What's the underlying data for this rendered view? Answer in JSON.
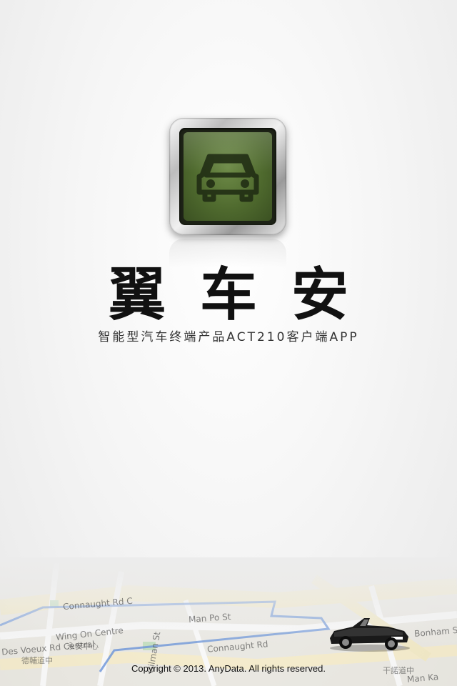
{
  "app": {
    "title": "翼车安",
    "subtitle": "智能型汽车终端产品ACT210客户端APP",
    "logo_icon": "car-icon"
  },
  "map": {
    "labels": {
      "connaught_rd_1": "Connaught Rd C",
      "connaught_rd_2": "Connaught Rd",
      "man_po_st": "Man Po St",
      "wing_on_centre": "Wing On Centre",
      "wing_on_centre_cn": "永安中心",
      "des_voeux_rd": "Des Voeux Rd Central",
      "des_voeux_rd_cn": "德輔道中",
      "gilman_st": "Gilman St",
      "man_kat": "Man Ka",
      "bonham": "Bonham Strand",
      "road_cn": "干諾道中"
    }
  },
  "footer": {
    "copyright": "Copyright © 2013. AnyData. All rights reserved."
  },
  "colors": {
    "screen_green": "#4f6a2e",
    "route_blue": "#6a93d8",
    "text_dark": "#111111"
  }
}
